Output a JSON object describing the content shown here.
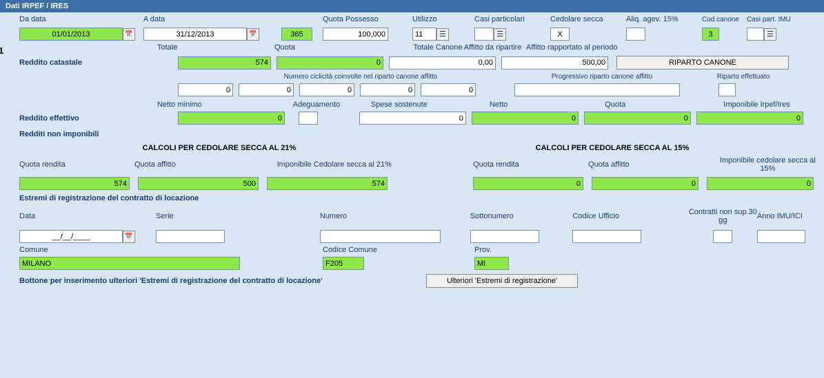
{
  "header": {
    "title": "Dati IRPEF / IRES"
  },
  "row_number": "1",
  "labels": {
    "da_data": "Da data",
    "a_data": "A data",
    "quota_possesso": "Quota Possesso",
    "utilizzo": "Utilizzo",
    "casi_particolari": "Casi particolari",
    "cedolare_secca": "Cedolare secca",
    "aliq_agev": "Aliq. agev. 15%",
    "cod_canone": "Cod.canone",
    "casi_part_imu": "Casi part. IMU",
    "totale": "Totale",
    "quota": "Quota",
    "tot_canone_affitto": "Totale Canone Affitto da ripartire",
    "affitto_rapportato": "Affitto rapportato al periodo",
    "reddito_catastale": "Reddito catastale",
    "riparto_canone": "RIPARTO CANONE",
    "num_ciclicita": "Numero ciclicità coinvolte nel riparto canone affitto",
    "progressivo_riparto": "Progressivo riparto canone affitto",
    "riparto_effettuato": "Riparto effettuato",
    "netto_minimo": "Netto minimo",
    "adeguamento": "Adeguamento",
    "spese_sostenute": "Spese sostenute",
    "netto": "Netto",
    "imponibile_irpef": "Imponibile Irpef/Ires",
    "reddito_effettivo": "Reddito effettivo",
    "redditi_non_imponibili": "Redditi non imponibili",
    "calc_21": "CALCOLI PER CEDOLARE SECCA AL 21%",
    "calc_15": "CALCOLI PER CEDOLARE SECCA AL 15%",
    "quota_rendita": "Quota rendita",
    "quota_affitto": "Quota affitto",
    "imp_ced_21": "Imponibile Cedolare secca al 21%",
    "imp_ced_15": "Imponibile cedolare secca al 15%",
    "estremi_reg": "Estremi di registrazione del contratto di locazione",
    "data": "Data",
    "serie": "Serie",
    "numero": "Numero",
    "sottonumero": "Sottonumero",
    "codice_ufficio": "Codice Ufficio",
    "contratti_non_sup": "Contratti non sup.30 gg",
    "anno_imu": "Anno IMU/ICI",
    "comune": "Comune",
    "codice_comune": "Codice Comune",
    "prov": "Prov.",
    "bottone_ulteriori": "Bottone per inserimento ulteriori 'Estremi di registrazione del contratto di locazione'",
    "ulteriori_estremi": "Ulteriori 'Estremi di registrazione'"
  },
  "values": {
    "da_data": "01/01/2013",
    "a_data": "31/12/2013",
    "giorni": "365",
    "quota_possesso": "100,000",
    "utilizzo": "11",
    "casi_particolari": "",
    "cedolare_secca": "X",
    "aliq_agev": "",
    "cod_canone": "3",
    "casi_part_imu": "",
    "rc_totale": "574",
    "rc_quota": "0",
    "tot_canone_affitto": "0,00",
    "affitto_rapportato": "500,00",
    "cicl1": "0",
    "cicl2": "0",
    "cicl3": "0",
    "cicl4": "0",
    "cicl5": "0",
    "progressivo_riparto": "",
    "riparto_effettuato": "",
    "re_netto_minimo": "0",
    "re_adeguamento": "",
    "re_spese_sostenute": "0",
    "re_netto": "0",
    "re_quota": "0",
    "re_imponibile": "0",
    "c21_quota_rendita": "574",
    "c21_quota_affitto": "500",
    "c21_imponibile": "574",
    "c15_quota_rendita": "0",
    "c15_quota_affitto": "0",
    "c15_imponibile": "0",
    "reg_data": "__/__/____",
    "reg_serie": "",
    "reg_numero": "",
    "reg_sottonumero": "",
    "reg_codice_ufficio": "",
    "reg_contratti": "",
    "reg_anno_imu": "",
    "reg_comune": "MILANO",
    "reg_codice_comune": "F205",
    "reg_prov": "MI"
  }
}
